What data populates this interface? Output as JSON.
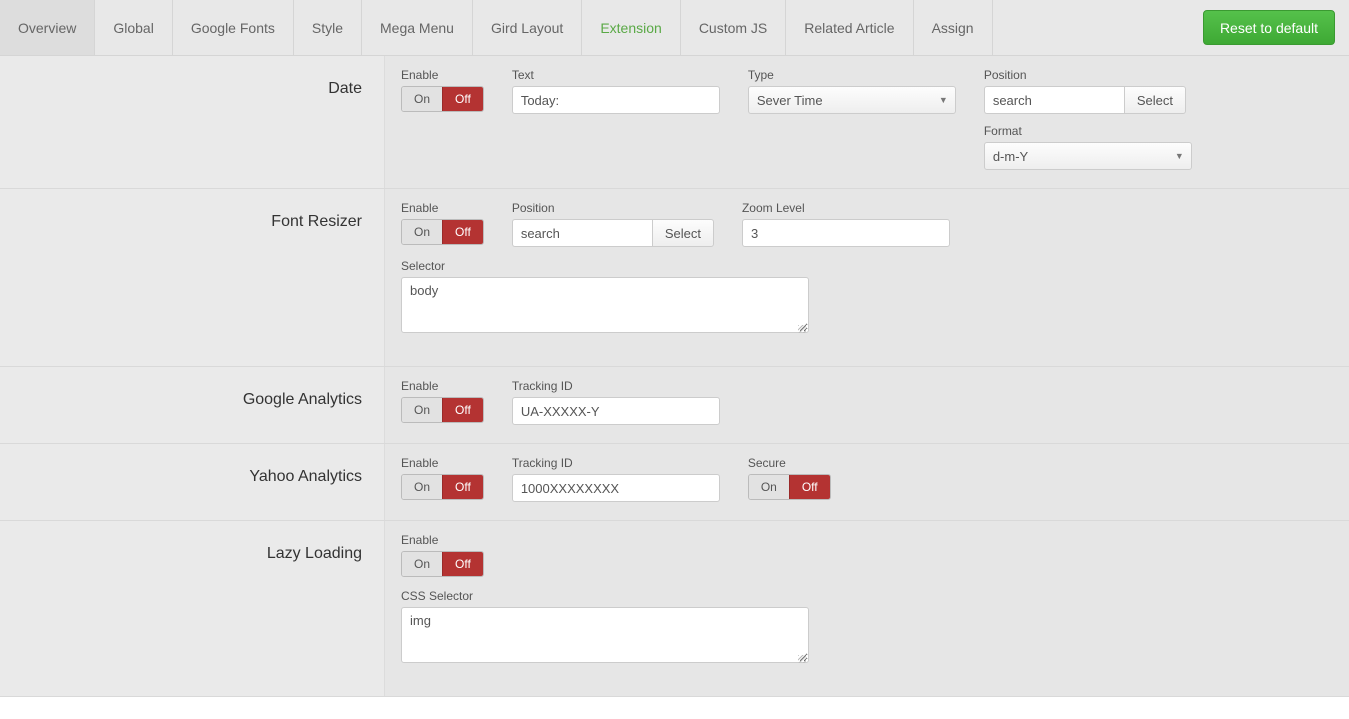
{
  "tabs": [
    "Overview",
    "Global",
    "Google Fonts",
    "Style",
    "Mega Menu",
    "Gird Layout",
    "Extension",
    "Custom JS",
    "Related Article",
    "Assign"
  ],
  "activeTab": "Extension",
  "reset_label": "Reset to default",
  "toggle": {
    "on": "On",
    "off": "Off"
  },
  "select_btn": "Select",
  "sections": {
    "date": {
      "title": "Date",
      "enable_label": "Enable",
      "text_label": "Text",
      "text_value": "Today:",
      "type_label": "Type",
      "type_value": "Sever Time",
      "position_label": "Position",
      "position_value": "search",
      "format_label": "Format",
      "format_value": "d-m-Y"
    },
    "font_resizer": {
      "title": "Font Resizer",
      "enable_label": "Enable",
      "position_label": "Position",
      "position_value": "search",
      "zoom_label": "Zoom Level",
      "zoom_value": "3",
      "selector_label": "Selector",
      "selector_value": "body"
    },
    "google_analytics": {
      "title": "Google Analytics",
      "enable_label": "Enable",
      "tracking_label": "Tracking ID",
      "tracking_value": "UA-XXXXX-Y"
    },
    "yahoo_analytics": {
      "title": "Yahoo Analytics",
      "enable_label": "Enable",
      "tracking_label": "Tracking ID",
      "tracking_value": "1000XXXXXXXX",
      "secure_label": "Secure"
    },
    "lazy_loading": {
      "title": "Lazy Loading",
      "enable_label": "Enable",
      "css_selector_label": "CSS Selector",
      "css_selector_value": "img"
    }
  }
}
